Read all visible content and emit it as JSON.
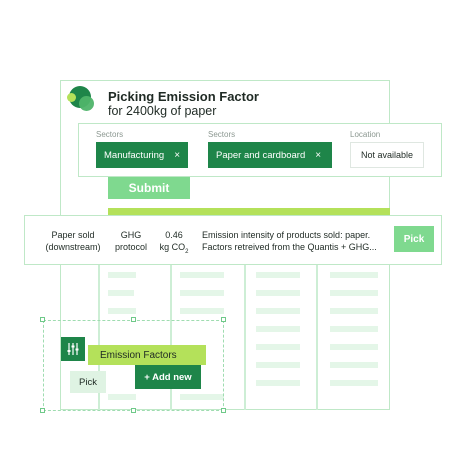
{
  "window": {
    "title": "Picking Emission Factor",
    "subtitle": "for 2400kg of paper"
  },
  "filters": {
    "sectors_label_1": "Sectors",
    "sectors_label_2": "Sectors",
    "location_label": "Location",
    "chip_1": "Manufacturing",
    "chip_2": "Paper and cardboard",
    "chip_remove_glyph": "×",
    "location_value": "Not available"
  },
  "submit_label": "Submit",
  "result": {
    "activity_line1": "Paper sold",
    "activity_line2": "(downstream)",
    "source_line1": "GHG",
    "source_line2": "protocol",
    "value_line1": "0.46",
    "value_line2_prefix": "kg CO",
    "value_line2_sub": "2",
    "desc_line1": "Emission intensity of products sold: paper.",
    "desc_line2": "Factors retreived from the Quantis + GHG...",
    "pick_label": "Pick"
  },
  "emission_factors": {
    "label": "Emission Factors",
    "pick_label": "Pick",
    "add_new_label": "+ Add new",
    "icon": "sliders-icon"
  },
  "colors": {
    "dark_green": "#1e8549",
    "light_green": "#7fd98f",
    "lime": "#b4e15a",
    "border": "#bfe8c7"
  }
}
